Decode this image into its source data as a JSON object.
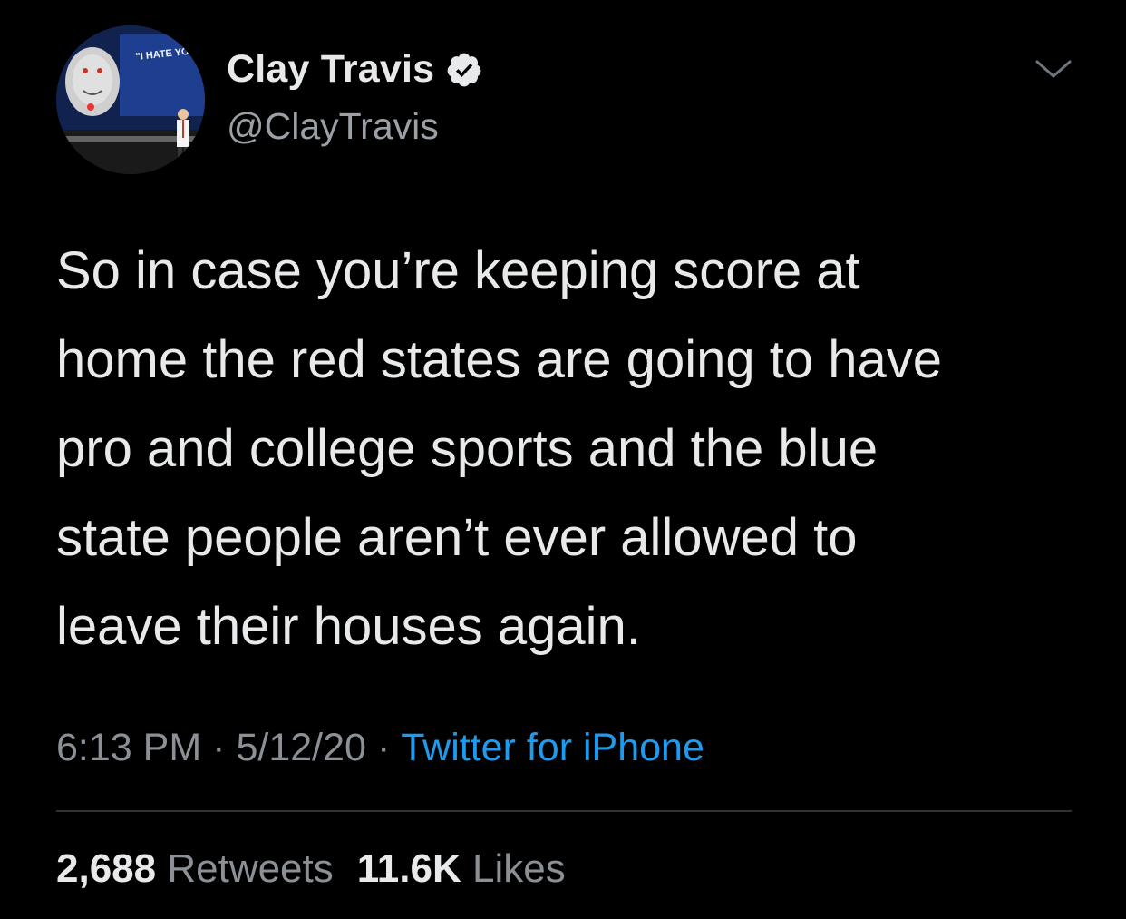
{
  "user": {
    "display_name": "Clay Travis",
    "handle": "@ClayTravis",
    "verified": true,
    "avatar_sign_text": "\"I HATE YOU CLAY TRAVIS\""
  },
  "tweet": {
    "text": "So in case you’re keeping score at\nhome the red states are going to have\npro and college sports and the blue\nstate people aren’t ever allowed to\nleave their houses again."
  },
  "meta": {
    "time": "6:13 PM",
    "separator": "·",
    "date": "5/12/20",
    "source": "Twitter for iPhone"
  },
  "stats": {
    "retweets_count": "2,688",
    "retweets_label": "Retweets",
    "likes_count": "11.6K",
    "likes_label": "Likes"
  },
  "colors": {
    "background": "#000000",
    "primary_text": "#E7E9EA",
    "secondary_text": "#8B9096",
    "link": "#1D9BF0",
    "divider": "#2F3336"
  },
  "icons": {
    "verified": "verified-badge-icon",
    "menu": "chevron-down-icon"
  }
}
